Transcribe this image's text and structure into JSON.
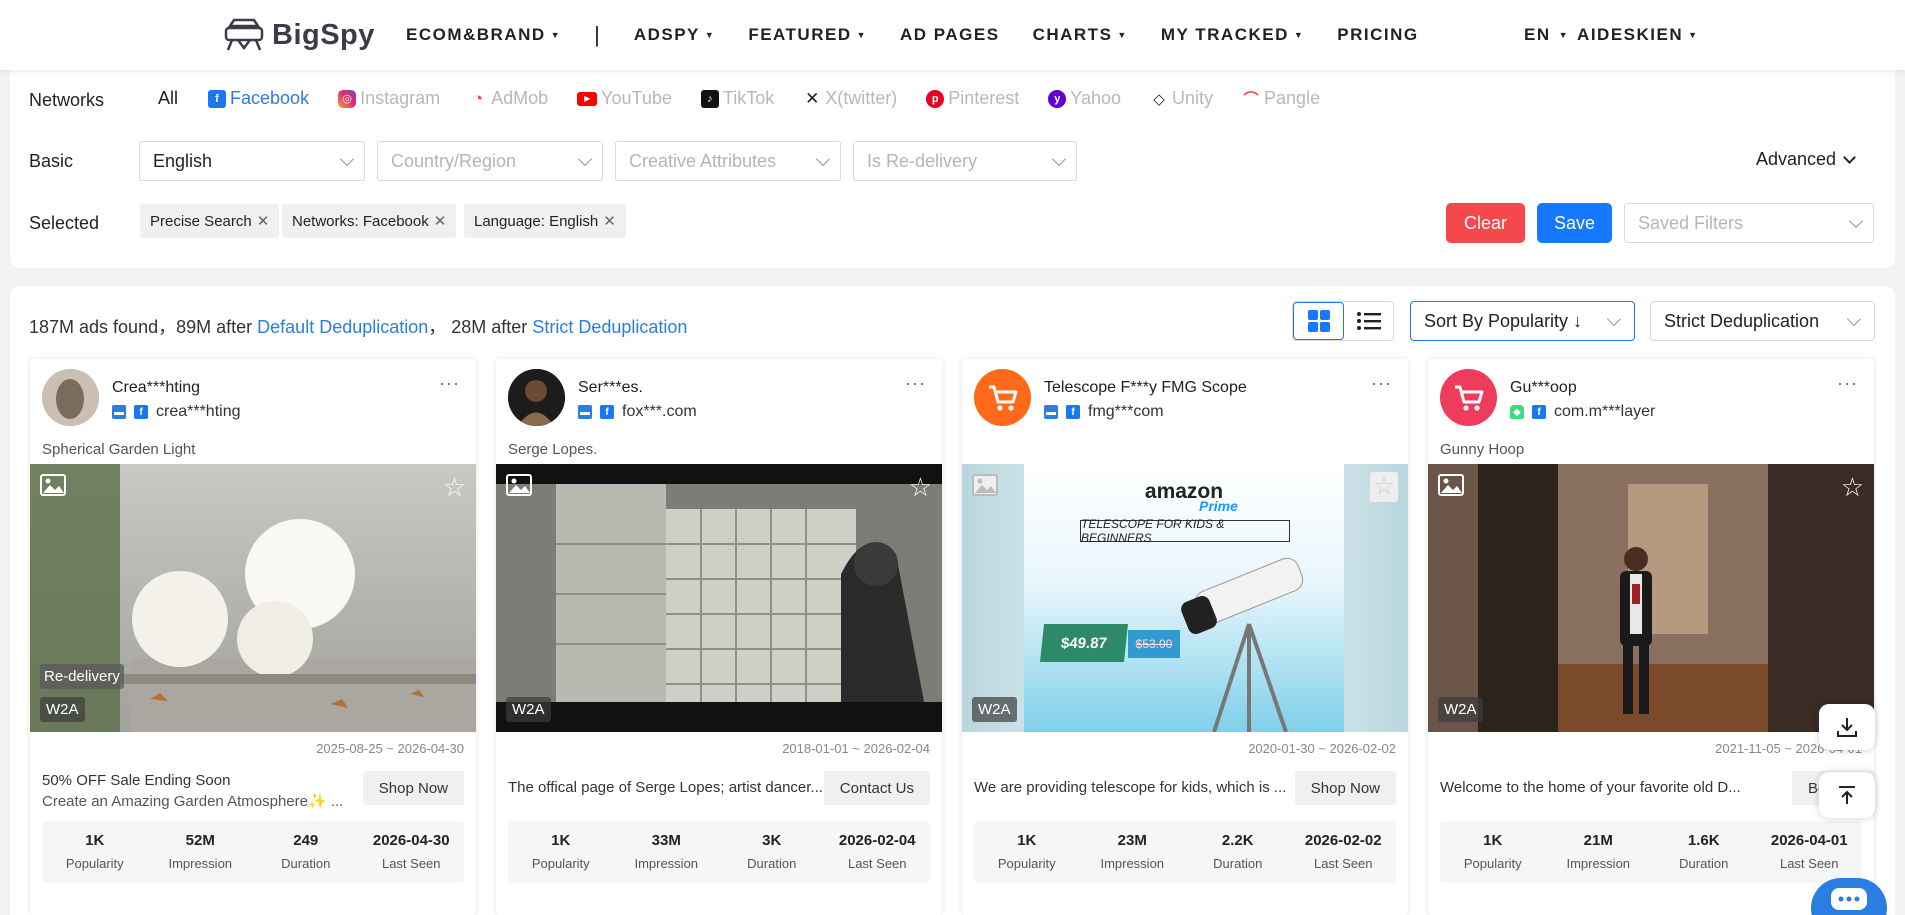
{
  "header": {
    "brand": "BigSpy",
    "nav": [
      {
        "label": "ECOM&BRAND",
        "caret": true
      },
      {
        "label": "ADSPY",
        "caret": true
      },
      {
        "label": "FEATURED",
        "caret": true
      },
      {
        "label": "AD PAGES",
        "caret": false
      },
      {
        "label": "CHARTS",
        "caret": true
      },
      {
        "label": "MY TRACKED",
        "caret": true
      },
      {
        "label": "PRICING",
        "caret": false
      }
    ],
    "separator": "|",
    "language": "EN",
    "user": "AIDESKIEN"
  },
  "filters": {
    "networks_label": "Networks",
    "networks": [
      "All",
      "Facebook",
      "Instagram",
      "AdMob",
      "YouTube",
      "TikTok",
      "X(twitter)",
      "Pinterest",
      "Yahoo",
      "Unity",
      "Pangle"
    ],
    "active_network": "Facebook",
    "basic_label": "Basic",
    "language_value": "English",
    "country_placeholder": "Country/Region",
    "creative_placeholder": "Creative Attributes",
    "redelivery_placeholder": "Is Re-delivery",
    "advanced_label": "Advanced",
    "selected_label": "Selected",
    "tags": [
      "Precise Search",
      "Networks: Facebook",
      "Language: English"
    ],
    "clear_label": "Clear",
    "save_label": "Save",
    "saved_filters_placeholder": "Saved Filters"
  },
  "results": {
    "count_text": "187M ads found，89M after",
    "default_dedup": "Default Deduplication",
    "mid_text": "， 28M after",
    "strict_dedup": "Strict Deduplication",
    "sort_value": "Sort By Popularity ↓",
    "dedup_value": "Strict Deduplication"
  },
  "cards": [
    {
      "advertiser": "Crea***hting",
      "domain": "crea***hting",
      "ad_title": "Spherical Garden Light",
      "badge": "W2A",
      "redelivery": "Re-delivery",
      "date_range": "2025-08-25 ~ 2026-04-30",
      "cta_text_1": "50% OFF Sale Ending Soon",
      "cta_text_2": "Create an Amazing Garden Atmosphere✨ ...",
      "cta_button": "Shop Now",
      "popularity": "1K",
      "impression": "52M",
      "duration": "249",
      "last_seen": "2026-04-30"
    },
    {
      "advertiser": "Ser***es.",
      "domain": "fox***.com",
      "ad_title": "Serge Lopes.",
      "badge": "W2A",
      "date_range": "2018-01-01 ~ 2026-02-04",
      "cta_text_1": "The offical page of Serge Lopes; artist dancer...",
      "cta_button": "Contact Us",
      "popularity": "1K",
      "impression": "33M",
      "duration": "3K",
      "last_seen": "2026-02-04"
    },
    {
      "advertiser": "Telescope F***y FMG Scope",
      "domain": "fmg***com",
      "ad_title": "",
      "badge": "W2A",
      "date_range": "2020-01-30 ~ 2026-02-02",
      "cta_text_1": "We are providing telescope for kids, which is ...",
      "cta_button": "Shop Now",
      "creative_brand": "amazon",
      "creative_brand_sub": "Prime",
      "creative_headline": "TELESCOPE FOR KIDS & BEGINNERS",
      "creative_price": "$49.87",
      "creative_old_price": "$53.00",
      "popularity": "1K",
      "impression": "23M",
      "duration": "2.2K",
      "last_seen": "2026-02-02"
    },
    {
      "advertiser": "Gu***oop",
      "domain": "com.m***layer",
      "ad_title": "Gunny Hoop",
      "badge": "W2A",
      "date_range": "2021-11-05 ~ 2026-04-01",
      "cta_text_1": "Welcome to the home of your favorite old D...",
      "cta_button": "Book Tra",
      "popularity": "1K",
      "impression": "21M",
      "duration": "1.6K",
      "last_seen": "2026-04-01"
    }
  ],
  "stat_labels": {
    "popularity": "Popularity",
    "impression": "Impression",
    "duration": "Duration",
    "last_seen": "Last Seen"
  },
  "colors": {
    "accent": "#1677ff",
    "link": "#2a7de1",
    "clear": "#f5484c",
    "shop_orange": "#ff6a1a",
    "shop_pink": "#ef3b5c"
  }
}
